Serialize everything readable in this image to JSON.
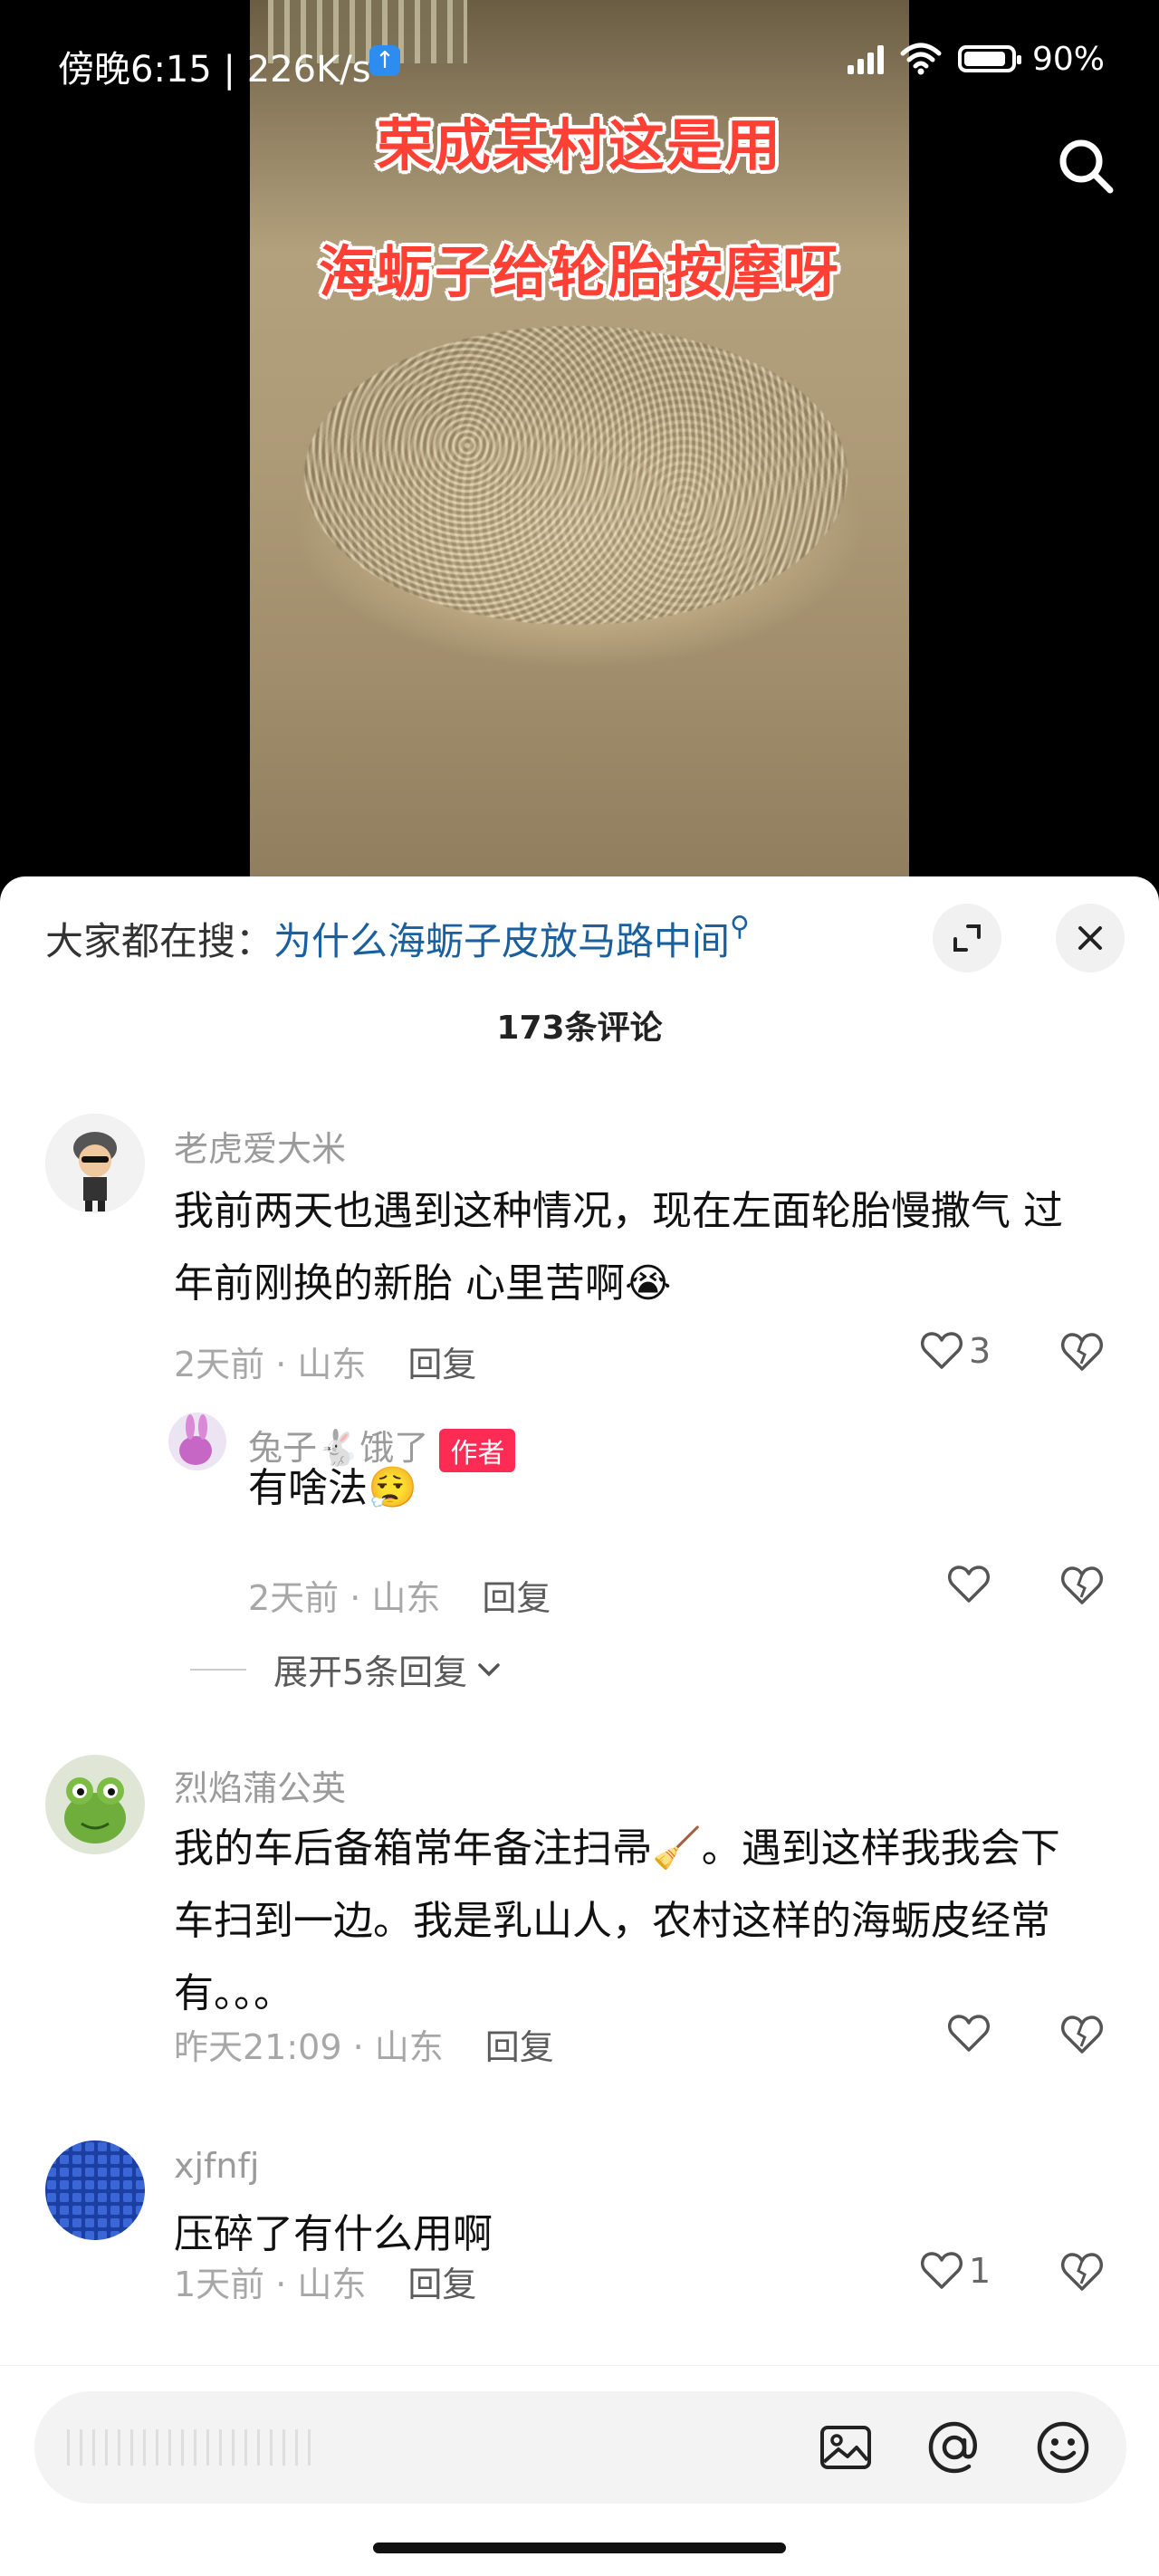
{
  "status_bar": {
    "time": "傍晚6:15 | 226K/s",
    "upload_icon": "arrow-up-icon",
    "battery": "90%",
    "battery_level": 0.9
  },
  "video": {
    "caption_line1": "荣成某村这是用",
    "caption_line2": "海蛎子给轮胎按摩呀",
    "search_icon": "search-icon"
  },
  "comments_panel": {
    "hot_search_label": "大家都在搜：",
    "hot_search_query": "为什么海蛎子皮放马路中间",
    "comment_count": "173条评论",
    "reply_label": "回复",
    "expand_replies": "展开5条回复",
    "comments": [
      {
        "user": "老虎爱大米",
        "text_line1": "我前两天也遇到这种情况，现在左面轮胎慢撒气  过",
        "text_line2": "年前刚换的新胎 心里苦啊😭",
        "time_location": "2天前 · 山东",
        "likes": "3"
      },
      {
        "user": "兔子🐇饿了",
        "badge": "作者",
        "text": "有啥法😮‍💨",
        "time_location": "2天前 · 山东",
        "likes": ""
      },
      {
        "user": "烈焰蒲公英",
        "text_line1": "我的车后备箱常年备注扫帚🧹。遇到这样我我会下",
        "text_line2": "车扫到一边。我是乳山人，农村这样的海蛎皮经常",
        "text_line3": "有。。。",
        "time_location": "昨天21:09 · 山东",
        "likes": ""
      },
      {
        "user": "xjfnfj",
        "text": "压碎了有什么用啊",
        "time_location": "1天前 · 山东",
        "likes": "1"
      }
    ]
  },
  "bottom_bar": {
    "image_icon": "image-icon",
    "mention_icon": "at-icon",
    "emoji_icon": "emoji-icon"
  }
}
